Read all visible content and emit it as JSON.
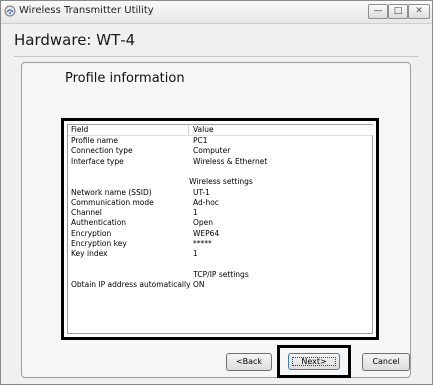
{
  "window": {
    "title": "Wireless Transmitter Utility",
    "controls": {
      "minimize": "—",
      "maximize": "□",
      "close": "✕"
    }
  },
  "header": {
    "title": "Hardware: WT‑4"
  },
  "panel": {
    "title": "Profile information"
  },
  "table": {
    "columns": [
      "Field",
      "Value"
    ],
    "rows": [
      {
        "type": "data",
        "field": "Profile name",
        "value": "PC1"
      },
      {
        "type": "data",
        "field": "Connection type",
        "value": "Computer"
      },
      {
        "type": "data",
        "field": "Interface type",
        "value": "Wireless & Ethernet"
      },
      {
        "type": "blank",
        "field": "",
        "value": ""
      },
      {
        "type": "section",
        "field": "",
        "value": "Wireless settings"
      },
      {
        "type": "data",
        "field": "Network name (SSID)",
        "value": "UT-1"
      },
      {
        "type": "data",
        "field": "Communication mode",
        "value": "Ad-hoc"
      },
      {
        "type": "data",
        "field": "Channel",
        "value": "1"
      },
      {
        "type": "data",
        "field": "Authentication",
        "value": "Open"
      },
      {
        "type": "data",
        "field": "Encryption",
        "value": "WEP64"
      },
      {
        "type": "data",
        "field": "Encryption key",
        "value": "*****"
      },
      {
        "type": "data",
        "field": "Key index",
        "value": "1"
      },
      {
        "type": "blank",
        "field": "",
        "value": ""
      },
      {
        "type": "section",
        "field": "",
        "value": "TCP/IP settings"
      },
      {
        "type": "data",
        "field": "Obtain IP address automatically",
        "value": "ON"
      }
    ]
  },
  "buttons": {
    "back": "<Back",
    "next": "Next>",
    "cancel": "Cancel"
  }
}
